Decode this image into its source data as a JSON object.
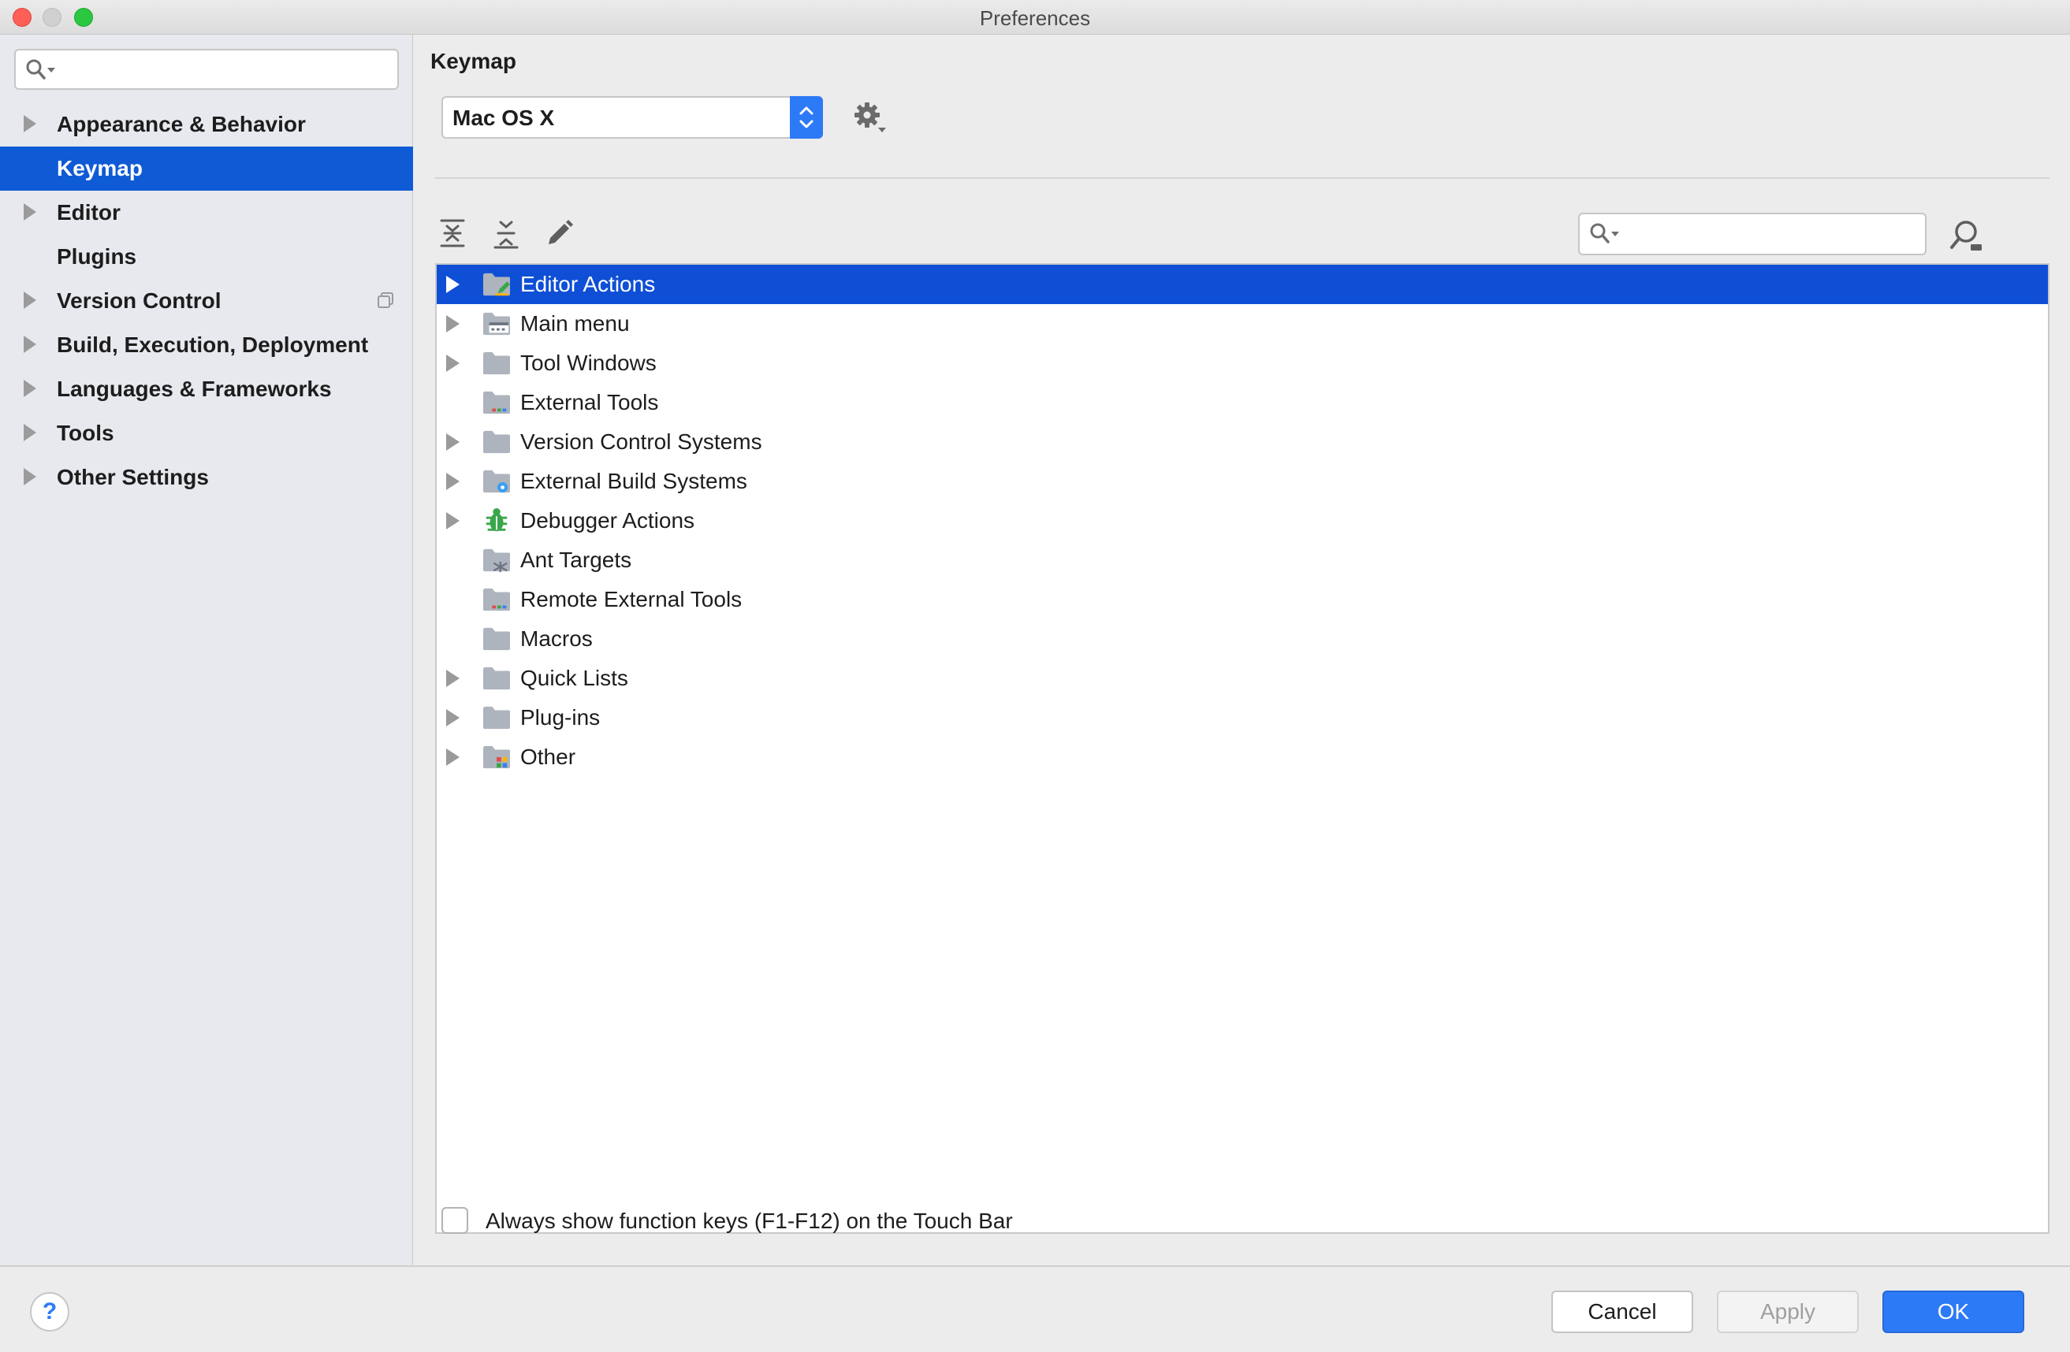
{
  "window": {
    "title": "Preferences"
  },
  "sidebar": {
    "search": {
      "placeholder": "",
      "value": ""
    },
    "items": [
      {
        "label": "Appearance & Behavior",
        "expandable": true,
        "selected": false
      },
      {
        "label": "Keymap",
        "expandable": false,
        "selected": true
      },
      {
        "label": "Editor",
        "expandable": true,
        "selected": false
      },
      {
        "label": "Plugins",
        "expandable": false,
        "selected": false
      },
      {
        "label": "Version Control",
        "expandable": true,
        "selected": false
      },
      {
        "label": "Build, Execution, Deployment",
        "expandable": true,
        "selected": false
      },
      {
        "label": "Languages & Frameworks",
        "expandable": true,
        "selected": false
      },
      {
        "label": "Tools",
        "expandable": true,
        "selected": false
      },
      {
        "label": "Other Settings",
        "expandable": true,
        "selected": false
      }
    ]
  },
  "main": {
    "title": "Keymap",
    "keymap_select": {
      "value": "Mac OS X"
    },
    "tree_search": {
      "placeholder": "",
      "value": ""
    },
    "tree": [
      {
        "label": "Editor Actions",
        "expandable": true,
        "selected": true,
        "icon": "folder-edit-icon"
      },
      {
        "label": "Main menu",
        "expandable": true,
        "selected": false,
        "icon": "folder-menu-icon"
      },
      {
        "label": "Tool Windows",
        "expandable": true,
        "selected": false,
        "icon": "folder-icon"
      },
      {
        "label": "External Tools",
        "expandable": false,
        "selected": false,
        "icon": "folder-tools-icon"
      },
      {
        "label": "Version Control Systems",
        "expandable": true,
        "selected": false,
        "icon": "folder-icon"
      },
      {
        "label": "External Build Systems",
        "expandable": true,
        "selected": false,
        "icon": "folder-gear-icon"
      },
      {
        "label": "Debugger Actions",
        "expandable": true,
        "selected": false,
        "icon": "bug-icon"
      },
      {
        "label": "Ant Targets",
        "expandable": false,
        "selected": false,
        "icon": "folder-ant-icon"
      },
      {
        "label": "Remote External Tools",
        "expandable": false,
        "selected": false,
        "icon": "folder-tools-icon"
      },
      {
        "label": "Macros",
        "expandable": false,
        "selected": false,
        "icon": "folder-icon"
      },
      {
        "label": "Quick Lists",
        "expandable": true,
        "selected": false,
        "icon": "folder-icon"
      },
      {
        "label": "Plug-ins",
        "expandable": true,
        "selected": false,
        "icon": "folder-icon"
      },
      {
        "label": "Other",
        "expandable": true,
        "selected": false,
        "icon": "folder-other-icon"
      }
    ],
    "touchbar_checkbox": {
      "label": "Always show function keys (F1-F12) on the Touch Bar",
      "checked": false
    }
  },
  "footer": {
    "help_label": "?",
    "cancel_label": "Cancel",
    "apply_label": "Apply",
    "ok_label": "OK"
  },
  "colors": {
    "selection": "#0f5bd6",
    "accent": "#2d7af7",
    "sidebar_bg": "#e7e9ee"
  }
}
